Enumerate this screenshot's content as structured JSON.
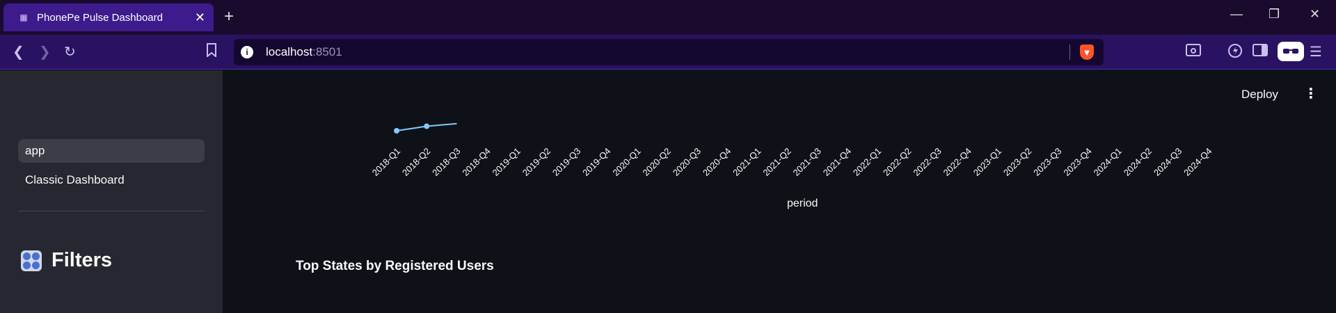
{
  "browser": {
    "tab_title": "PhonePe Pulse Dashboard",
    "tab_close": "✕",
    "new_tab": "+",
    "url_host": "localhost",
    "url_port": ":8501",
    "info_icon": "i",
    "brave_icon": "brave-lion-icon"
  },
  "window": {
    "minimize": "—",
    "restore": "❐",
    "close": "✕"
  },
  "sidebar": {
    "items": [
      {
        "label": "app",
        "active": true
      },
      {
        "label": "Classic Dashboard",
        "active": false
      }
    ],
    "filters_title": "Filters"
  },
  "header": {
    "deploy_label": "Deploy",
    "menu_label": "⋮"
  },
  "main": {
    "section_title": "Top States by Registered Users"
  },
  "chart_data": {
    "type": "line",
    "xlabel": "period",
    "categories": [
      "2018-Q1",
      "2018-Q2",
      "2018-Q3",
      "2018-Q4",
      "2019-Q1",
      "2019-Q2",
      "2019-Q3",
      "2019-Q4",
      "2020-Q1",
      "2020-Q2",
      "2020-Q3",
      "2020-Q4",
      "2021-Q1",
      "2021-Q2",
      "2021-Q3",
      "2021-Q4",
      "2022-Q1",
      "2022-Q2",
      "2022-Q3",
      "2022-Q4",
      "2023-Q1",
      "2023-Q2",
      "2023-Q3",
      "2023-Q4",
      "2024-Q1",
      "2024-Q2",
      "2024-Q3",
      "2024-Q4"
    ],
    "series": [
      {
        "values": [
          0.0,
          0.35,
          0.55
        ]
      }
    ],
    "colors": {
      "line": "#83c9ff",
      "text": "#fafafa"
    }
  }
}
